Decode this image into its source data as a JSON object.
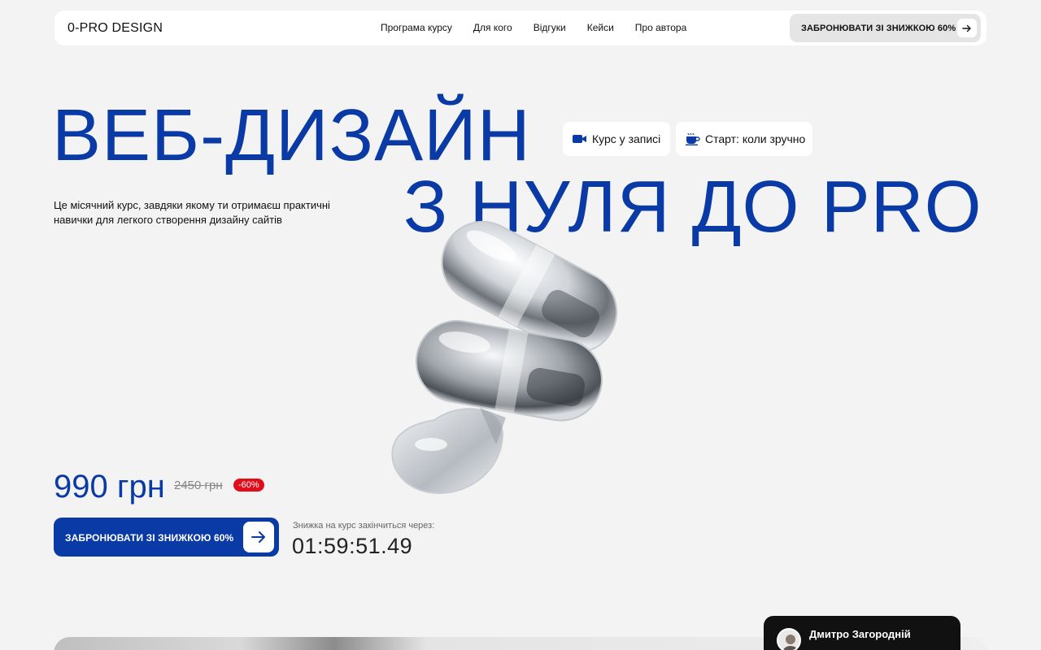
{
  "nav": {
    "logo": "0-PRO DESIGN",
    "items": [
      "Програма курсу",
      "Для кого",
      "Відгуки",
      "Кейси",
      "Про автора"
    ],
    "cta": "ЗАБРОНЮВАТИ ЗІ ЗНИЖКОЮ 60%"
  },
  "hero": {
    "title_line1": "ВЕБ-ДИЗАЙН",
    "title_line2": "З НУЛЯ ДО PRO",
    "chips": [
      {
        "icon": "video-camera-icon",
        "label": "Курс у записі"
      },
      {
        "icon": "coffee-cup-icon",
        "label": "Старт: коли зручно"
      }
    ],
    "lead": "Це місячний курс, завдяки якому ти отримаєш практичні навички для легкого створення дизайну сайтів"
  },
  "pricing": {
    "price": "990 грн",
    "old_price": "2450 грн",
    "discount": "-60%",
    "cta": "ЗАБРОНЮВАТИ ЗІ ЗНИЖКОЮ 60%",
    "timer_label": "Знижка на курс закінчиться через:",
    "timer": "01:59:51.49"
  },
  "author": {
    "name": "Дмитро Загородній"
  },
  "colors": {
    "brand": "#0a3aa5",
    "badge": "#e00e1a",
    "background": "#f3f3f3"
  }
}
